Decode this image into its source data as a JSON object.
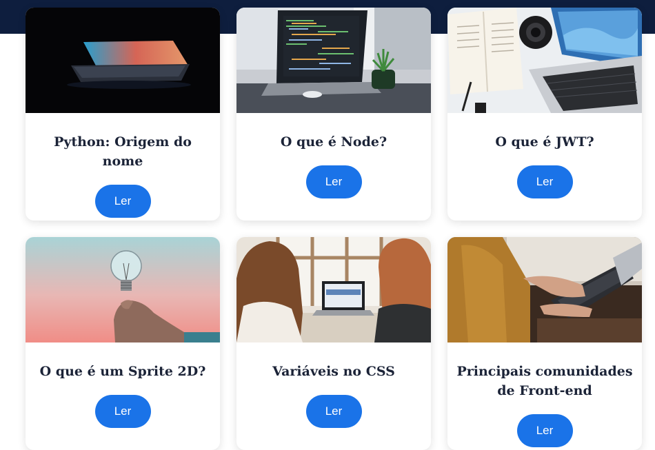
{
  "colors": {
    "accent": "#1a73e8",
    "header": "#0e1e3e",
    "title_text": "#1b2337"
  },
  "posts": [
    {
      "title": "Python: Origem do nome",
      "button_label": "Ler",
      "image": "laptop-glow-dark-image"
    },
    {
      "title": "O que é Node?",
      "button_label": "Ler",
      "image": "laptop-code-desk-image"
    },
    {
      "title": "O que é JWT?",
      "button_label": "Ler",
      "image": "laptop-book-camera-image"
    },
    {
      "title": "O que é um Sprite 2D?",
      "button_label": "Ler",
      "image": "hand-lightbulb-image"
    },
    {
      "title": "Variáveis no CSS",
      "button_label": "Ler",
      "image": "two-women-laptop-image"
    },
    {
      "title": "Principais comunidades de Front-end",
      "button_label": "Ler",
      "image": "typing-laptop-image"
    }
  ]
}
